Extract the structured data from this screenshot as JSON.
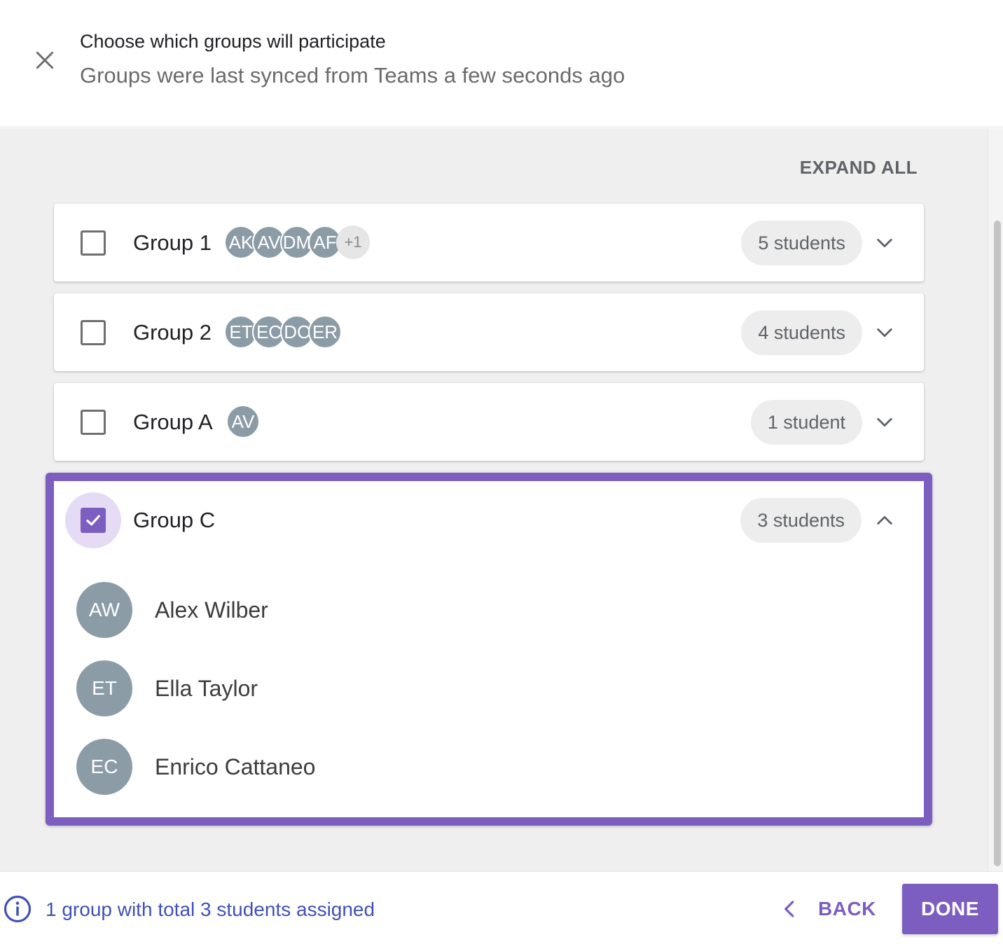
{
  "header": {
    "title": "Choose which groups will participate",
    "subtitle": "Groups were last synced from Teams a few seconds ago",
    "close_icon": "close-icon"
  },
  "toolbar": {
    "expand_all_label": "EXPAND ALL"
  },
  "groups": [
    {
      "name": "Group 1",
      "checked": false,
      "expanded": false,
      "avatars": [
        "AK",
        "AV",
        "DM",
        "AF"
      ],
      "more": "+1",
      "count_label": "5 students"
    },
    {
      "name": "Group 2",
      "checked": false,
      "expanded": false,
      "avatars": [
        "ET",
        "EC",
        "DC",
        "ER"
      ],
      "more": "",
      "count_label": "4 students"
    },
    {
      "name": "Group A",
      "checked": false,
      "expanded": false,
      "avatars": [
        "AV"
      ],
      "more": "",
      "count_label": "1 student"
    },
    {
      "name": "Group C",
      "checked": true,
      "expanded": true,
      "count_label": "3 students",
      "members": [
        {
          "initials": "AW",
          "name": "Alex Wilber"
        },
        {
          "initials": "ET",
          "name": "Ella Taylor"
        },
        {
          "initials": "EC",
          "name": "Enrico Cattaneo"
        }
      ]
    }
  ],
  "footer": {
    "info_text": "1 group with total 3 students assigned",
    "back_label": "BACK",
    "done_label": "DONE"
  },
  "colors": {
    "accent": "#7b5ec0",
    "accent_light": "#e5dbf5",
    "avatar": "#8c9ca7",
    "info_text": "#3f51b5",
    "background": "#efefef"
  }
}
